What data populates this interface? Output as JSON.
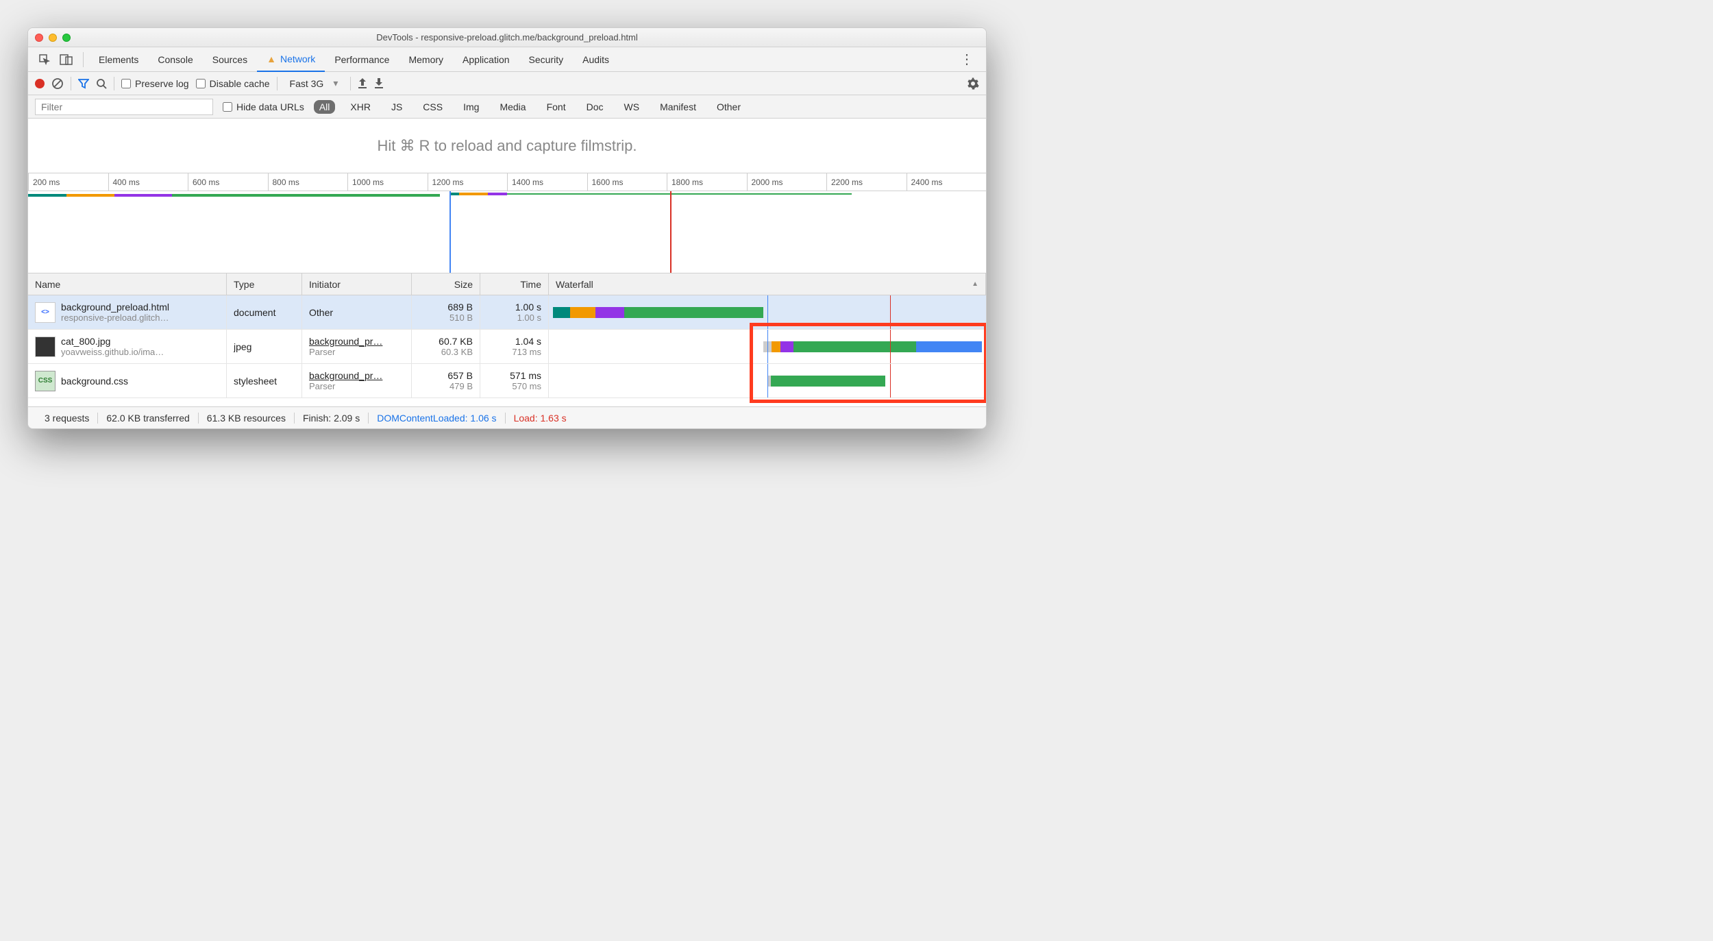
{
  "window_title": "DevTools - responsive-preload.glitch.me/background_preload.html",
  "tabs": [
    "Elements",
    "Console",
    "Sources",
    "Network",
    "Performance",
    "Memory",
    "Application",
    "Security",
    "Audits"
  ],
  "active_tab": "Network",
  "toolbar": {
    "preserve_log": "Preserve log",
    "disable_cache": "Disable cache",
    "throttle": "Fast 3G"
  },
  "filterbar": {
    "placeholder": "Filter",
    "hide_data_urls": "Hide data URLs",
    "types": [
      "All",
      "XHR",
      "JS",
      "CSS",
      "Img",
      "Media",
      "Font",
      "Doc",
      "WS",
      "Manifest",
      "Other"
    ],
    "active_type": "All"
  },
  "filmstrip_hint": "Hit ⌘ R to reload and capture filmstrip.",
  "ruler_ticks": [
    "200 ms",
    "400 ms",
    "600 ms",
    "800 ms",
    "1000 ms",
    "1200 ms",
    "1400 ms",
    "1600 ms",
    "1800 ms",
    "2000 ms",
    "2200 ms",
    "2400 ms"
  ],
  "columns": {
    "name": "Name",
    "type": "Type",
    "initiator": "Initiator",
    "size": "Size",
    "time": "Time",
    "waterfall": "Waterfall"
  },
  "requests": [
    {
      "name": "background_preload.html",
      "sub": "responsive-preload.glitch…",
      "type": "document",
      "initiator": "Other",
      "initiator_sub": "",
      "size": "689 B",
      "size_sub": "510 B",
      "time": "1.00 s",
      "time_sub": "1.00 s",
      "icon": "html",
      "selected": true
    },
    {
      "name": "cat_800.jpg",
      "sub": "yoavweiss.github.io/ima…",
      "type": "jpeg",
      "initiator": "background_pr…",
      "initiator_sub": "Parser",
      "size": "60.7 KB",
      "size_sub": "60.3 KB",
      "time": "1.04 s",
      "time_sub": "713 ms",
      "icon": "img",
      "selected": false
    },
    {
      "name": "background.css",
      "sub": "",
      "type": "stylesheet",
      "initiator": "background_pr…",
      "initiator_sub": "Parser",
      "size": "657 B",
      "size_sub": "479 B",
      "time": "571 ms",
      "time_sub": "570 ms",
      "icon": "css",
      "selected": false
    }
  ],
  "status": {
    "requests": "3 requests",
    "transferred": "62.0 KB transferred",
    "resources": "61.3 KB resources",
    "finish": "Finish: 2.09 s",
    "dcl": "DOMContentLoaded: 1.06 s",
    "load": "Load: 1.63 s"
  },
  "colors": {
    "blue": "#4285f4",
    "green": "#34a853",
    "orange": "#f29900",
    "purple": "#9334e6",
    "teal": "#00897b",
    "red": "#d93025"
  }
}
